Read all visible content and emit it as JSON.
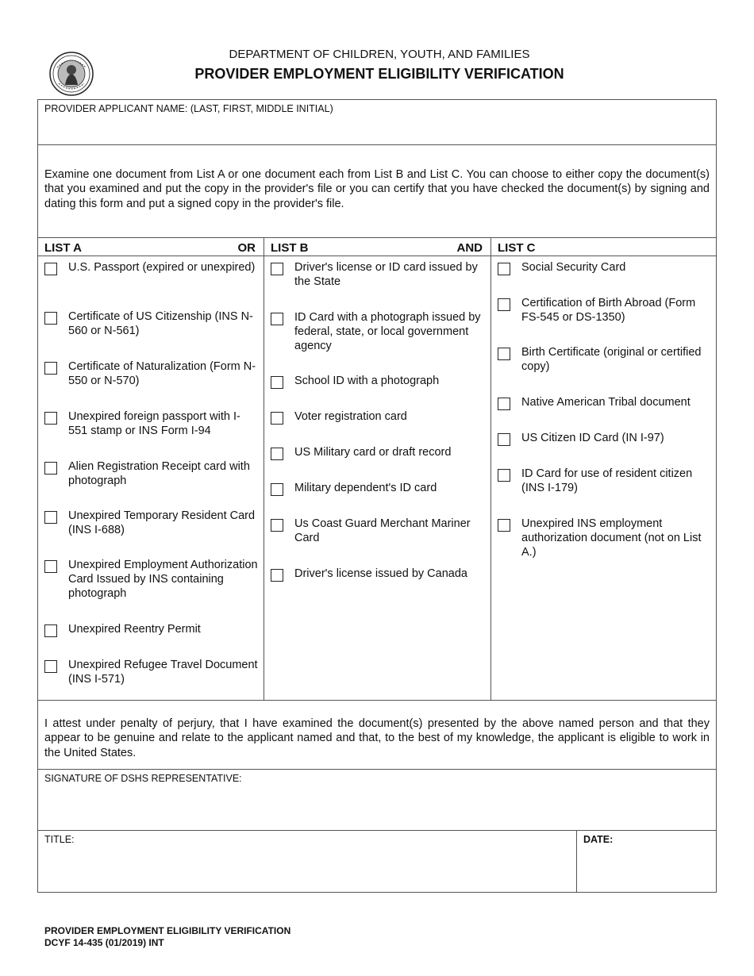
{
  "header": {
    "department": "DEPARTMENT OF CHILDREN, YOUTH, AND FAMILIES",
    "title": "PROVIDER EMPLOYMENT ELIGIBILITY VERIFICATION",
    "seal_icon": "state-seal-icon"
  },
  "applicant": {
    "label": "PROVIDER APPLICANT NAME: (LAST, FIRST, MIDDLE INITIAL)",
    "value": ""
  },
  "instructions": "Examine one document from List A or one document each from List B and List C.  You can choose to either copy the document(s) that you examined and put the copy in the provider's file or you can certify that you have checked the document(s) by signing and dating this form and put a signed copy in the provider's file.",
  "lists": [
    {
      "title": "LIST A",
      "connector": "OR",
      "items": [
        {
          "label": "U.S. Passport (expired or unexpired)",
          "checked": false
        },
        {
          "label": "Certificate of US Citizenship (INS N-560 or N-561)",
          "checked": false
        },
        {
          "label": "Certificate of Naturalization (Form N-550 or N-570)",
          "checked": false
        },
        {
          "label": "Unexpired foreign passport with I-551 stamp or INS Form I-94",
          "checked": false
        },
        {
          "label": "Alien Registration Receipt card with photograph",
          "checked": false
        },
        {
          "label": "Unexpired Temporary Resident Card (INS I-688)",
          "checked": false
        },
        {
          "label": "Unexpired Employment Authorization Card Issued by INS containing photograph",
          "checked": false
        },
        {
          "label": "Unexpired Reentry Permit",
          "checked": false
        },
        {
          "label": "Unexpired Refugee Travel Document (INS I-571)",
          "checked": false
        }
      ]
    },
    {
      "title": "LIST B",
      "connector": "AND",
      "items": [
        {
          "label": "Driver's license or ID card issued by the State",
          "checked": false
        },
        {
          "label": "ID Card with a photograph issued by federal, state, or local government agency",
          "checked": false
        },
        {
          "label": "School ID with a photograph",
          "checked": false
        },
        {
          "label": "Voter registration card",
          "checked": false
        },
        {
          "label": "US Military card or draft record",
          "checked": false
        },
        {
          "label": "Military dependent's ID card",
          "checked": false
        },
        {
          "label": "Us Coast Guard Merchant Mariner Card",
          "checked": false
        },
        {
          "label": "Driver's license issued by Canada",
          "checked": false
        }
      ]
    },
    {
      "title": "LIST C",
      "connector": "",
      "items": [
        {
          "label": "Social Security Card",
          "checked": false
        },
        {
          "label": "Certification of Birth Abroad (Form FS-545 or DS-1350)",
          "checked": false
        },
        {
          "label": "Birth Certificate (original or certified copy)",
          "checked": false
        },
        {
          "label": "Native American Tribal document",
          "checked": false
        },
        {
          "label": "US Citizen ID Card (IN I-97)",
          "checked": false
        },
        {
          "label": "ID Card for use of resident citizen (INS I-179)",
          "checked": false
        },
        {
          "label": "Unexpired INS employment authorization document (not on List A.)",
          "checked": false
        }
      ]
    }
  ],
  "attestation": "I attest under penalty of perjury, that I have examined the document(s) presented by the above named person and that they appear to be genuine and relate to the applicant named and that, to the best of my knowledge, the applicant is eligible to work in the United States.",
  "signature": {
    "label": "SIGNATURE OF DSHS REPRESENTATIVE:",
    "value": ""
  },
  "title_field": {
    "label": "TITLE:",
    "value": ""
  },
  "date_field": {
    "label": "DATE:",
    "value": ""
  },
  "footer": {
    "line1": "PROVIDER EMPLOYMENT ELIGIBILITY VERIFICATION",
    "line2": "DCYF 14-435 (01/2019) INT"
  }
}
